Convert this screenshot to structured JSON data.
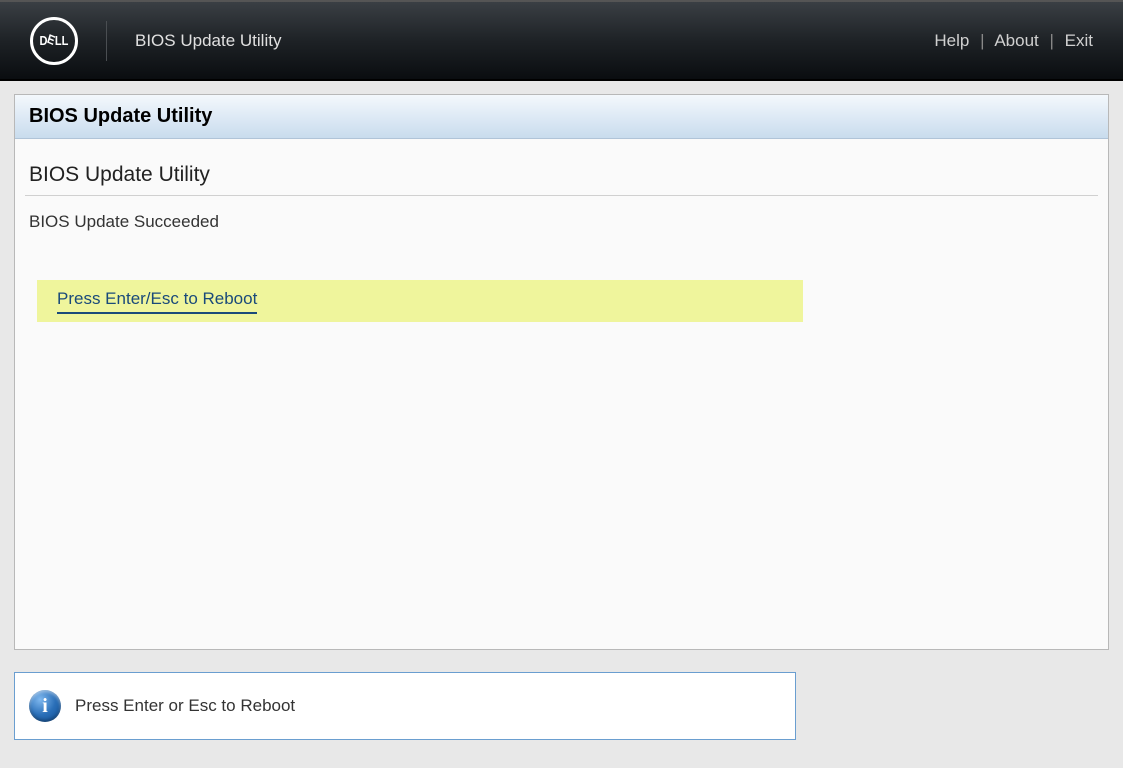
{
  "header": {
    "logo_text": "DELL",
    "app_title": "BIOS Update Utility",
    "links": {
      "help": "Help",
      "about": "About",
      "exit": "Exit"
    }
  },
  "panel": {
    "panel_title": "BIOS Update Utility",
    "section_title": "BIOS Update Utility",
    "status_message": "BIOS Update Succeeded",
    "action_prompt": "Press Enter/Esc to Reboot"
  },
  "info_bar": {
    "message": "Press Enter or Esc to Reboot"
  }
}
